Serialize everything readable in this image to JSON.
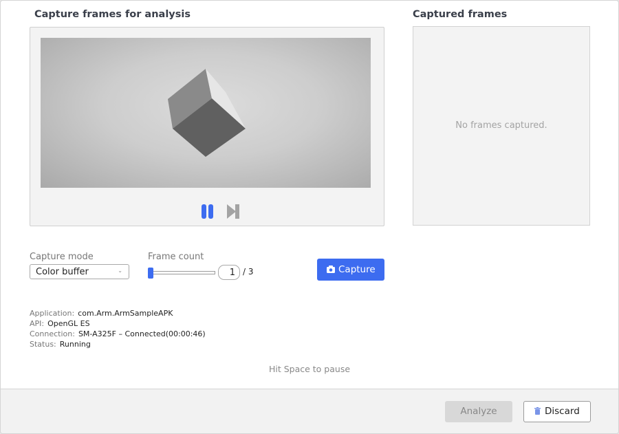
{
  "capture_panel": {
    "title": "Capture frames for analysis",
    "controls": {
      "pause_icon": "pause-icon",
      "step_icon": "step-forward-icon"
    }
  },
  "captured_panel": {
    "title": "Captured frames",
    "empty_text": "No frames captured."
  },
  "capture_mode": {
    "label": "Capture mode",
    "selected": "Color buffer",
    "chevron": "⌄"
  },
  "frame_count": {
    "label": "Frame count",
    "value": "1",
    "max_text": "/ 3",
    "slider_value": 1,
    "slider_min": 1,
    "slider_max": 3
  },
  "capture_button": {
    "label": "Capture",
    "icon": "camera-icon"
  },
  "info": [
    {
      "key": "Application:",
      "value": "com.Arm.ArmSampleAPK"
    },
    {
      "key": "API:",
      "value": "OpenGL ES"
    },
    {
      "key": "Connection:",
      "value": "SM-A325F – Connected(00:00:46)"
    },
    {
      "key": "Status:",
      "value": "Running"
    }
  ],
  "hint": "Hit Space to pause",
  "footer": {
    "analyze_label": "Analyze",
    "discard_label": "Discard",
    "discard_icon": "trash-icon"
  },
  "colors": {
    "accent": "#3d6cf0",
    "disabled_bg": "#d8d8d8"
  }
}
